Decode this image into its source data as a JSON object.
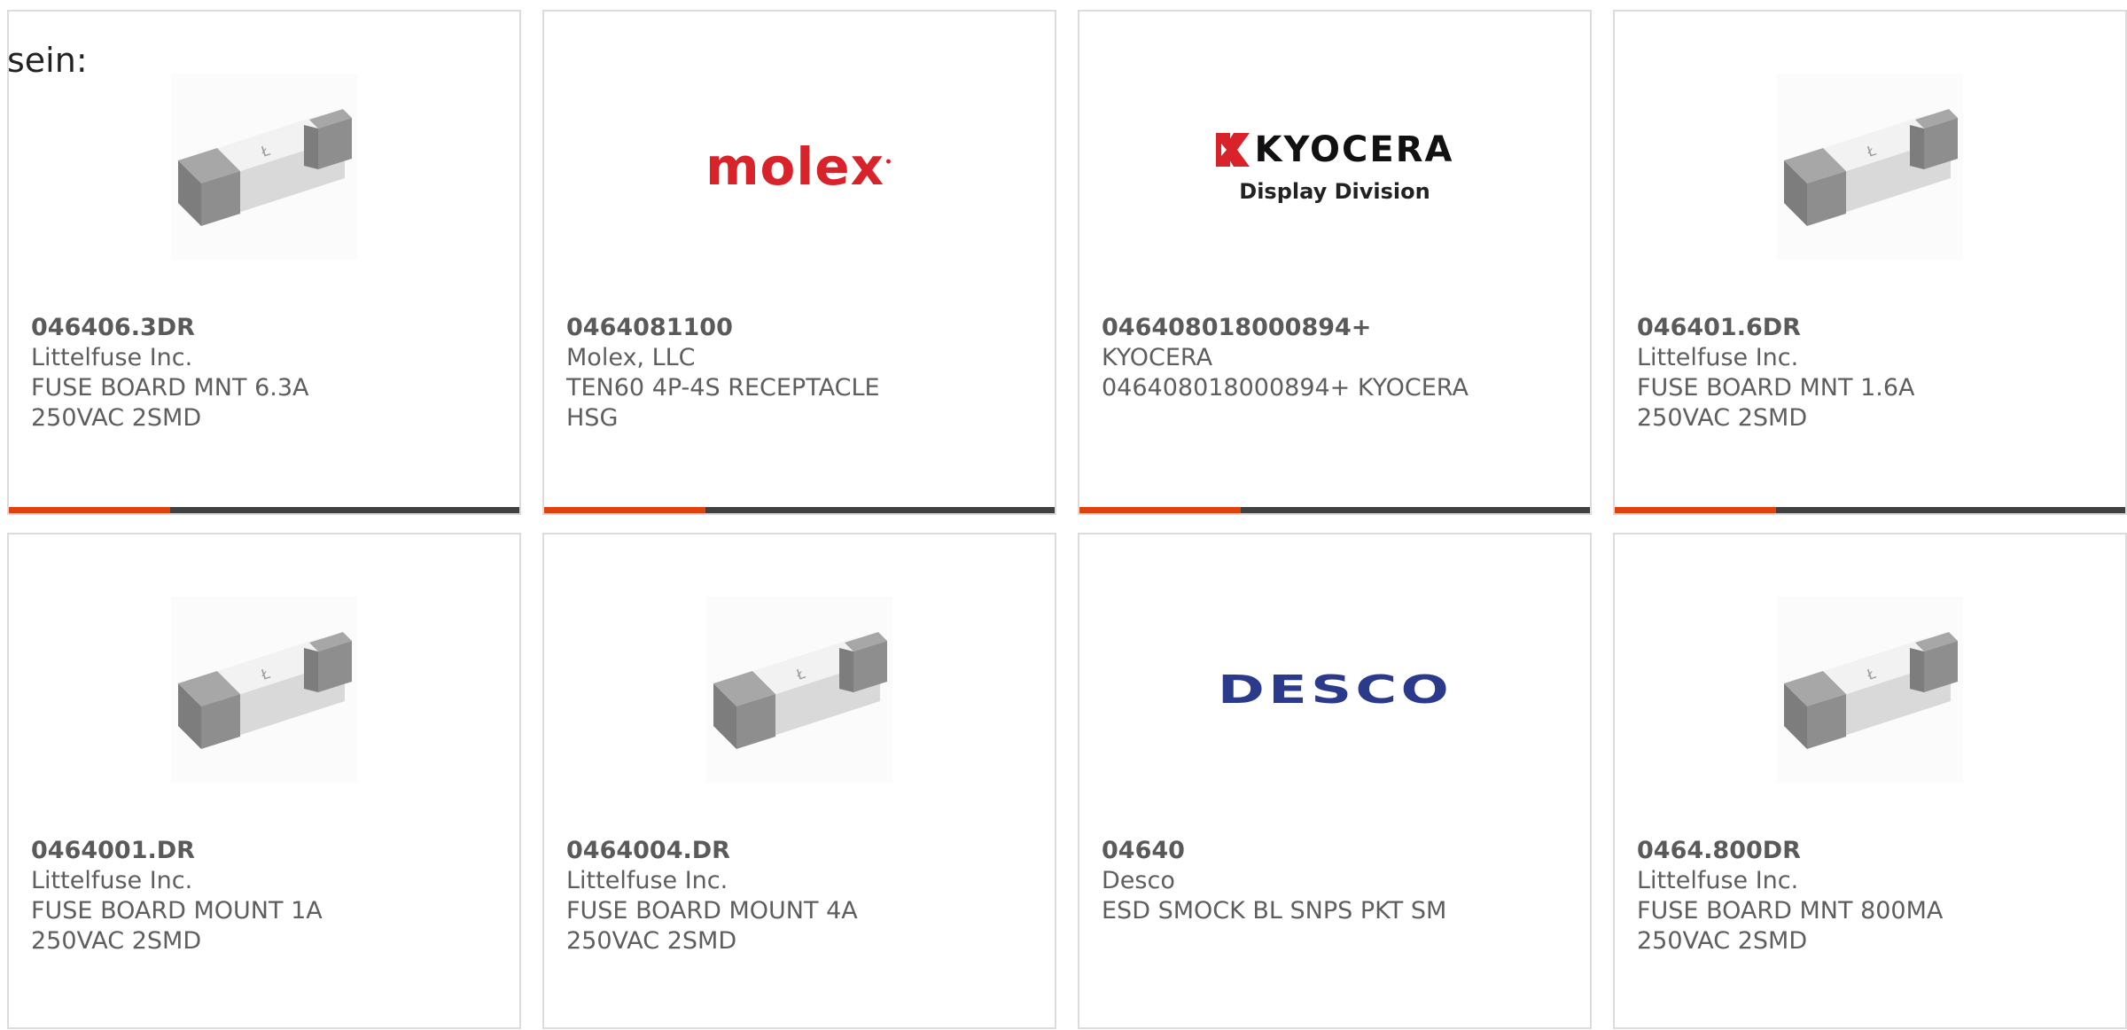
{
  "intro_text": "sein:",
  "colors": {
    "accent": "#e0420d",
    "bar": "#404040",
    "border": "#dcdcdc",
    "molex_red": "#d8232a",
    "kyocera_red": "#d8232a",
    "desco_blue": "#2c3a8c"
  },
  "products": [
    {
      "part_number": "046406.3DR",
      "manufacturer": "Littelfuse Inc.",
      "description": "FUSE BOARD MNT 6.3A 250VAC 2SMD",
      "image": "fuse-image"
    },
    {
      "part_number": "0464081100",
      "manufacturer": "Molex, LLC",
      "description": "TEN60 4P-4S RECEPTACLE HSG",
      "image": "molex-logo",
      "logo_text": "molex"
    },
    {
      "part_number": "046408018000894+",
      "manufacturer": "KYOCERA",
      "description": "046408018000894+ KYOCERA",
      "image": "kyocera-logo",
      "logo_text": "KYOCERA",
      "logo_sub": "Display Division"
    },
    {
      "part_number": "046401.6DR",
      "manufacturer": "Littelfuse Inc.",
      "description": "FUSE BOARD MNT 1.6A 250VAC 2SMD",
      "image": "fuse-image"
    },
    {
      "part_number": "0464001.DR",
      "manufacturer": "Littelfuse Inc.",
      "description": "FUSE BOARD MOUNT 1A 250VAC 2SMD",
      "image": "fuse-image"
    },
    {
      "part_number": "0464004.DR",
      "manufacturer": "Littelfuse Inc.",
      "description": "FUSE BOARD MOUNT 4A 250VAC 2SMD",
      "image": "fuse-image"
    },
    {
      "part_number": "04640",
      "manufacturer": "Desco",
      "description": "ESD SMOCK BL SNPS PKT SM",
      "image": "desco-logo",
      "logo_text": "DESCO"
    },
    {
      "part_number": "0464.800DR",
      "manufacturer": "Littelfuse Inc.",
      "description": "FUSE BOARD MNT 800MA 250VAC 2SMD",
      "image": "fuse-image"
    }
  ]
}
